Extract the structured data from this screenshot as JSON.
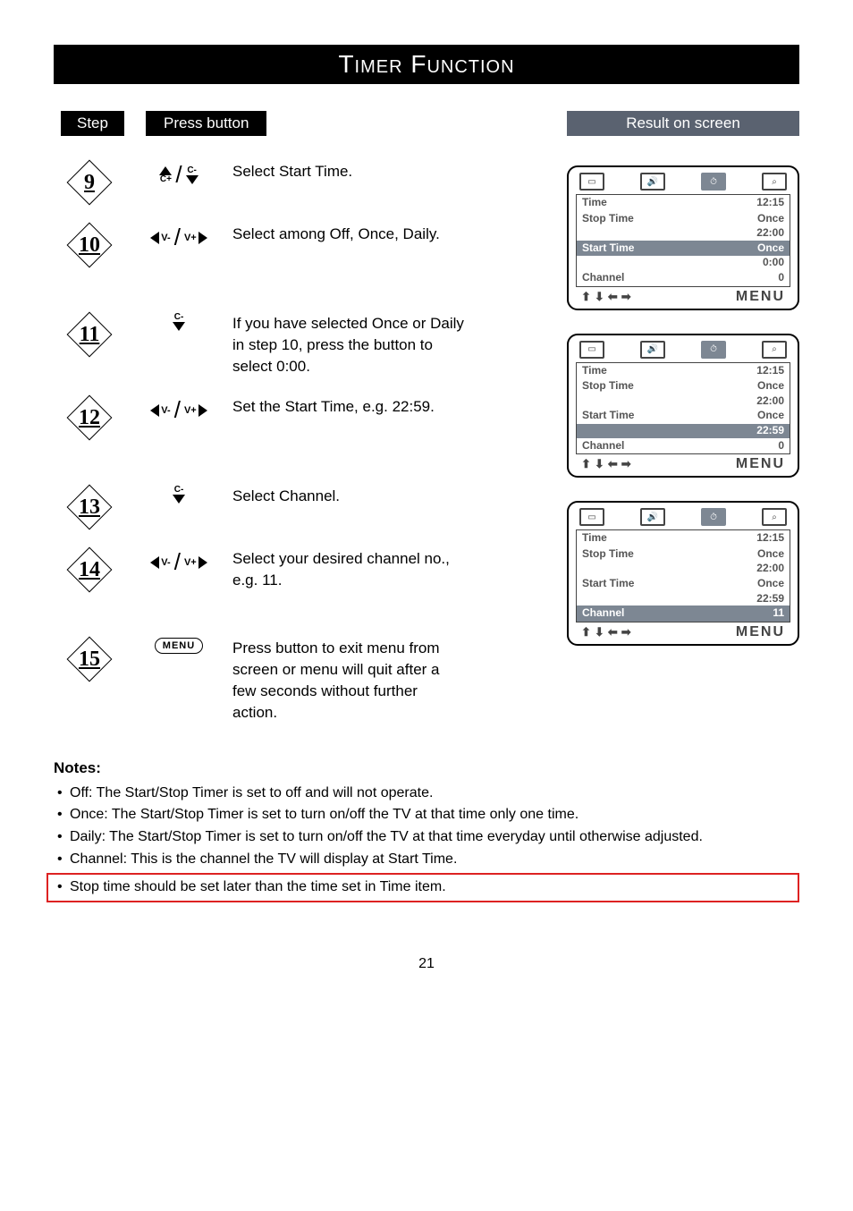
{
  "title": "Timer Function",
  "headers": {
    "step": "Step",
    "press": "Press  button",
    "result": "Result  on  screen"
  },
  "steps": [
    {
      "num": "9",
      "button": "C+ / C-",
      "desc": "Select Start Time."
    },
    {
      "num": "10",
      "button": "V- / V+",
      "desc": "Select among Off, Once, Daily."
    },
    {
      "num": "11",
      "button": "C-",
      "desc": "If you have selected Once or Daily in step 10, press the button to select 0:00."
    },
    {
      "num": "12",
      "button": "V- / V+",
      "desc": "Set the Start Time, e.g. 22:59."
    },
    {
      "num": "13",
      "button": "C-",
      "desc": "Select Channel."
    },
    {
      "num": "14",
      "button": "V- / V+",
      "desc": "Select your desired channel no., e.g. 11."
    },
    {
      "num": "15",
      "button": "MENU",
      "desc": "Press button to exit menu from screen or menu will quit after a few seconds without further action."
    }
  ],
  "osd_labels": {
    "time": "Time",
    "stop": "Stop Time",
    "start": "Start Time",
    "channel": "Channel",
    "menu": "MENU"
  },
  "screens": [
    {
      "rows": [
        {
          "l": "Time",
          "r": "12:15",
          "hl": false
        },
        {
          "l": "Stop Time",
          "r": "Once",
          "hl": false
        },
        {
          "sub": "22:00"
        },
        {
          "l": "Start Time",
          "r": "Once",
          "hl": true
        },
        {
          "sub": "0:00"
        },
        {
          "l": "Channel",
          "r": "0",
          "hl": false
        }
      ]
    },
    {
      "rows": [
        {
          "l": "Time",
          "r": "12:15",
          "hl": false
        },
        {
          "l": "Stop Time",
          "r": "Once",
          "hl": false
        },
        {
          "sub": "22:00"
        },
        {
          "l": "Start Time",
          "r": "Once",
          "hl": false
        },
        {
          "sub": "22:59",
          "hl": true
        },
        {
          "l": "Channel",
          "r": "0",
          "hl": false
        }
      ]
    },
    {
      "rows": [
        {
          "l": "Time",
          "r": "12:15",
          "hl": false
        },
        {
          "l": "Stop Time",
          "r": "Once",
          "hl": false
        },
        {
          "sub": "22:00"
        },
        {
          "l": "Start Time",
          "r": "Once",
          "hl": false
        },
        {
          "sub": "22:59"
        },
        {
          "l": "Channel",
          "r": "11",
          "hl": true
        }
      ]
    }
  ],
  "notes_header": "Notes:",
  "notes": [
    "Off: The Start/Stop Timer is set to off and will not operate.",
    "Once: The Start/Stop Timer is set to turn on/off the TV at that time only one time.",
    "Daily: The Start/Stop Timer is set to turn on/off the TV at that time everyday until otherwise adjusted.",
    "Channel: This is the channel the TV will display at Start Time.",
    "Stop time should be set later than the time set in Time item."
  ],
  "page_number": "21"
}
